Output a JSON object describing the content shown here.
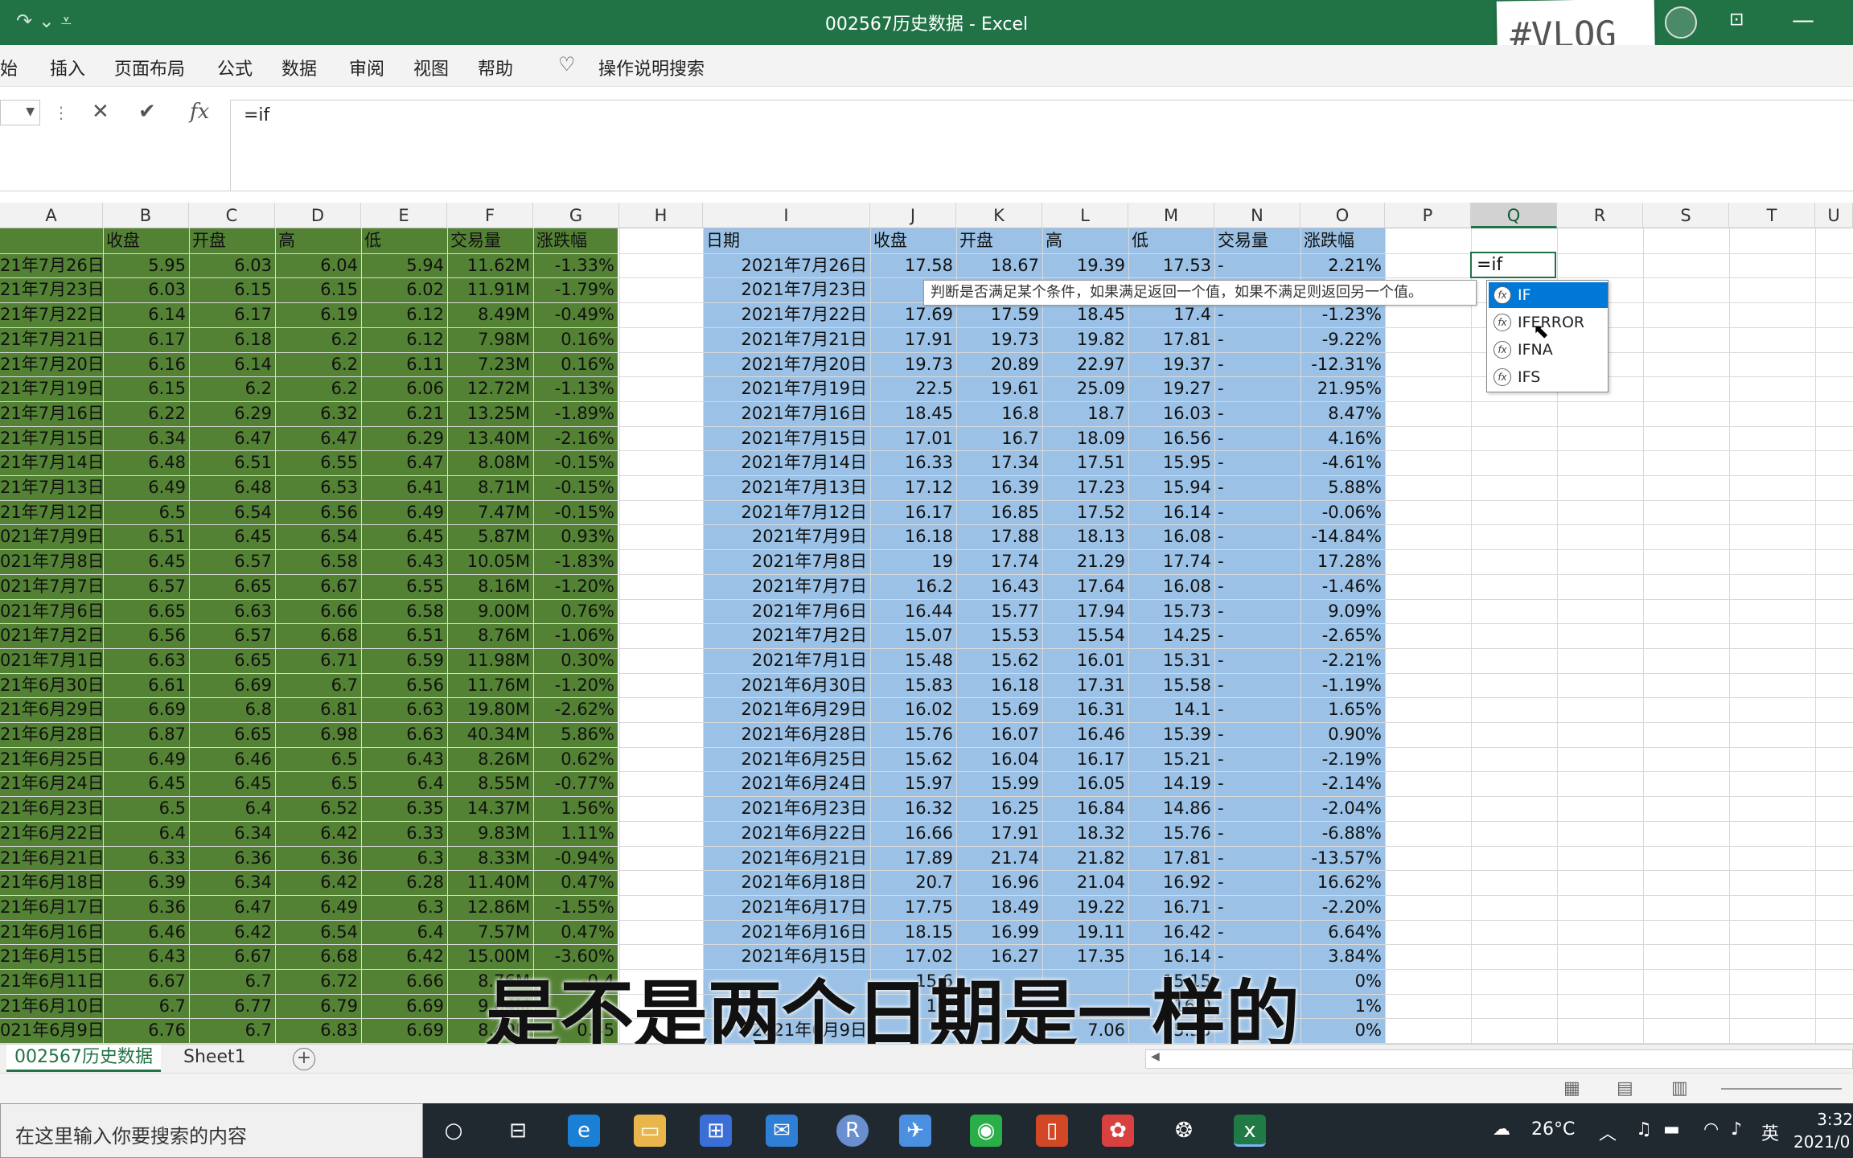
{
  "window": {
    "title": "002567历史数据  -  Excel"
  },
  "sticker": {
    "text": "#VLOG"
  },
  "menu": [
    "开始",
    "插入",
    "页面布局",
    "公式",
    "数据",
    "审阅",
    "视图",
    "帮助"
  ],
  "menu_shown": [
    "始",
    "插入",
    "页面布局",
    "公式",
    "数据",
    "审阅",
    "视图",
    "帮助"
  ],
  "tell_me": "操作说明搜索",
  "formula_bar": {
    "cancel": "✕",
    "enter": "✔",
    "fx": "fx",
    "content": "=if"
  },
  "columns": [
    "A",
    "B",
    "C",
    "D",
    "E",
    "F",
    "G",
    "H",
    "I",
    "J",
    "K",
    "L",
    "M",
    "N",
    "O",
    "P",
    "Q",
    "R",
    "S",
    "T",
    "U"
  ],
  "selected_column": "Q",
  "left_headers": {
    "a": "",
    "b": "收盘",
    "c": "开盘",
    "d": "高",
    "e": "低",
    "f": "交易量",
    "g": "涨跌幅"
  },
  "right_headers": {
    "i": "日期",
    "j": "收盘",
    "k": "开盘",
    "l": "高",
    "m": "低",
    "n": "交易量",
    "o": "涨跌幅"
  },
  "left_rows": [
    [
      "21年7月26日",
      "5.95",
      "6.03",
      "6.04",
      "5.94",
      "11.62M",
      "-1.33%"
    ],
    [
      "21年7月23日",
      "6.03",
      "6.15",
      "6.15",
      "6.02",
      "11.91M",
      "-1.79%"
    ],
    [
      "21年7月22日",
      "6.14",
      "6.17",
      "6.19",
      "6.12",
      "8.49M",
      "-0.49%"
    ],
    [
      "21年7月21日",
      "6.17",
      "6.18",
      "6.2",
      "6.12",
      "7.98M",
      "0.16%"
    ],
    [
      "21年7月20日",
      "6.16",
      "6.14",
      "6.2",
      "6.11",
      "7.23M",
      "0.16%"
    ],
    [
      "21年7月19日",
      "6.15",
      "6.2",
      "6.2",
      "6.06",
      "12.72M",
      "-1.13%"
    ],
    [
      "21年7月16日",
      "6.22",
      "6.29",
      "6.32",
      "6.21",
      "13.25M",
      "-1.89%"
    ],
    [
      "21年7月15日",
      "6.34",
      "6.47",
      "6.47",
      "6.29",
      "13.40M",
      "-2.16%"
    ],
    [
      "21年7月14日",
      "6.48",
      "6.51",
      "6.55",
      "6.47",
      "8.08M",
      "-0.15%"
    ],
    [
      "21年7月13日",
      "6.49",
      "6.48",
      "6.53",
      "6.41",
      "8.71M",
      "-0.15%"
    ],
    [
      "21年7月12日",
      "6.5",
      "6.54",
      "6.56",
      "6.49",
      "7.47M",
      "-0.15%"
    ],
    [
      "021年7月9日",
      "6.51",
      "6.45",
      "6.54",
      "6.45",
      "5.87M",
      "0.93%"
    ],
    [
      "021年7月8日",
      "6.45",
      "6.57",
      "6.58",
      "6.43",
      "10.05M",
      "-1.83%"
    ],
    [
      "021年7月7日",
      "6.57",
      "6.65",
      "6.67",
      "6.55",
      "8.16M",
      "-1.20%"
    ],
    [
      "021年7月6日",
      "6.65",
      "6.63",
      "6.66",
      "6.58",
      "9.00M",
      "0.76%"
    ],
    [
      "021年7月2日",
      "6.56",
      "6.57",
      "6.68",
      "6.51",
      "8.76M",
      "-1.06%"
    ],
    [
      "021年7月1日",
      "6.63",
      "6.65",
      "6.71",
      "6.59",
      "11.98M",
      "0.30%"
    ],
    [
      "21年6月30日",
      "6.61",
      "6.69",
      "6.7",
      "6.56",
      "11.76M",
      "-1.20%"
    ],
    [
      "21年6月29日",
      "6.69",
      "6.8",
      "6.81",
      "6.63",
      "19.80M",
      "-2.62%"
    ],
    [
      "21年6月28日",
      "6.87",
      "6.65",
      "6.98",
      "6.63",
      "40.34M",
      "5.86%"
    ],
    [
      "21年6月25日",
      "6.49",
      "6.46",
      "6.5",
      "6.43",
      "8.26M",
      "0.62%"
    ],
    [
      "21年6月24日",
      "6.45",
      "6.45",
      "6.5",
      "6.4",
      "8.55M",
      "-0.77%"
    ],
    [
      "21年6月23日",
      "6.5",
      "6.4",
      "6.52",
      "6.35",
      "14.37M",
      "1.56%"
    ],
    [
      "21年6月22日",
      "6.4",
      "6.34",
      "6.42",
      "6.33",
      "9.83M",
      "1.11%"
    ],
    [
      "21年6月21日",
      "6.33",
      "6.36",
      "6.36",
      "6.3",
      "8.33M",
      "-0.94%"
    ],
    [
      "21年6月18日",
      "6.39",
      "6.34",
      "6.42",
      "6.28",
      "11.40M",
      "0.47%"
    ],
    [
      "21年6月17日",
      "6.36",
      "6.47",
      "6.49",
      "6.3",
      "12.86M",
      "-1.55%"
    ],
    [
      "21年6月16日",
      "6.46",
      "6.42",
      "6.54",
      "6.4",
      "7.57M",
      "0.47%"
    ],
    [
      "21年6月15日",
      "6.43",
      "6.67",
      "6.68",
      "6.42",
      "15.00M",
      "-3.60%"
    ],
    [
      "21年6月11日",
      "6.67",
      "6.7",
      "6.72",
      "6.66",
      "8.76M",
      "-0.4"
    ],
    [
      "21年6月10日",
      "6.7",
      "6.77",
      "6.79",
      "6.69",
      "9.04M",
      ""
    ],
    [
      "021年6月9日",
      "6.76",
      "6.7",
      "6.83",
      "6.69",
      "8.49M",
      "0.45"
    ]
  ],
  "right_rows": [
    [
      "2021年7月26日",
      "17.58",
      "18.67",
      "19.39",
      "17.53",
      "-",
      "2.21%"
    ],
    [
      "2021年7月23日",
      "",
      "",
      "",
      "",
      "",
      ""
    ],
    [
      "2021年7月22日",
      "17.69",
      "17.59",
      "18.45",
      "17.4",
      "-",
      "-1.23%"
    ],
    [
      "2021年7月21日",
      "17.91",
      "19.73",
      "19.82",
      "17.81",
      "-",
      "-9.22%"
    ],
    [
      "2021年7月20日",
      "19.73",
      "20.89",
      "22.97",
      "19.37",
      "-",
      "-12.31%"
    ],
    [
      "2021年7月19日",
      "22.5",
      "19.61",
      "25.09",
      "19.27",
      "-",
      "21.95%"
    ],
    [
      "2021年7月16日",
      "18.45",
      "16.8",
      "18.7",
      "16.03",
      "-",
      "8.47%"
    ],
    [
      "2021年7月15日",
      "17.01",
      "16.7",
      "18.09",
      "16.56",
      "-",
      "4.16%"
    ],
    [
      "2021年7月14日",
      "16.33",
      "17.34",
      "17.51",
      "15.95",
      "-",
      "-4.61%"
    ],
    [
      "2021年7月13日",
      "17.12",
      "16.39",
      "17.23",
      "15.94",
      "-",
      "5.88%"
    ],
    [
      "2021年7月12日",
      "16.17",
      "16.85",
      "17.52",
      "16.14",
      "-",
      "-0.06%"
    ],
    [
      "2021年7月9日",
      "16.18",
      "17.88",
      "18.13",
      "16.08",
      "-",
      "-14.84%"
    ],
    [
      "2021年7月8日",
      "19",
      "17.74",
      "21.29",
      "17.74",
      "-",
      "17.28%"
    ],
    [
      "2021年7月7日",
      "16.2",
      "16.43",
      "17.64",
      "16.08",
      "-",
      "-1.46%"
    ],
    [
      "2021年7月6日",
      "16.44",
      "15.77",
      "17.94",
      "15.73",
      "-",
      "9.09%"
    ],
    [
      "2021年7月2日",
      "15.07",
      "15.53",
      "15.54",
      "14.25",
      "-",
      "-2.65%"
    ],
    [
      "2021年7月1日",
      "15.48",
      "15.62",
      "16.01",
      "15.31",
      "-",
      "-2.21%"
    ],
    [
      "2021年6月30日",
      "15.83",
      "16.18",
      "17.31",
      "15.58",
      "-",
      "-1.19%"
    ],
    [
      "2021年6月29日",
      "16.02",
      "15.69",
      "16.31",
      "14.1",
      "-",
      "1.65%"
    ],
    [
      "2021年6月28日",
      "15.76",
      "16.07",
      "16.46",
      "15.39",
      "-",
      "0.90%"
    ],
    [
      "2021年6月25日",
      "15.62",
      "16.04",
      "16.17",
      "15.21",
      "-",
      "-2.19%"
    ],
    [
      "2021年6月24日",
      "15.97",
      "15.99",
      "16.05",
      "14.19",
      "-",
      "-2.14%"
    ],
    [
      "2021年6月23日",
      "16.32",
      "16.25",
      "16.84",
      "14.86",
      "-",
      "-2.04%"
    ],
    [
      "2021年6月22日",
      "16.66",
      "17.91",
      "18.32",
      "15.76",
      "-",
      "-6.88%"
    ],
    [
      "2021年6月21日",
      "17.89",
      "21.74",
      "21.82",
      "17.81",
      "-",
      "-13.57%"
    ],
    [
      "2021年6月18日",
      "20.7",
      "16.96",
      "21.04",
      "16.92",
      "-",
      "16.62%"
    ],
    [
      "2021年6月17日",
      "17.75",
      "18.49",
      "19.22",
      "16.71",
      "-",
      "-2.20%"
    ],
    [
      "2021年6月16日",
      "18.15",
      "16.99",
      "19.11",
      "16.42",
      "-",
      "6.64%"
    ],
    [
      "2021年6月15日",
      "17.02",
      "16.27",
      "17.35",
      "16.14",
      "-",
      "3.84%"
    ],
    [
      "",
      "15.6",
      "",
      "",
      "15.15",
      "",
      "0%"
    ],
    [
      "",
      "16.",
      "",
      "",
      "16.0",
      "",
      "1%"
    ],
    [
      "2021年6月9日",
      "",
      "",
      "7.06",
      "15.55",
      "",
      "0%"
    ]
  ],
  "active_cell": {
    "value": "=if"
  },
  "tooltip": "判断是否满足某个条件，如果满足返回一个值，如果不满足则返回另一个值。",
  "autocomplete": [
    {
      "label": "IF",
      "selected": true
    },
    {
      "label": "IFERROR",
      "selected": false
    },
    {
      "label": "IFNA",
      "selected": false
    },
    {
      "label": "IFS",
      "selected": false
    }
  ],
  "subtitle": "是不是两个日期是一样的",
  "sheets": [
    {
      "label": "002567历史数据",
      "active": true
    },
    {
      "label": "Sheet1",
      "active": false
    }
  ],
  "add_sheet": "+",
  "taskbar": {
    "search_placeholder": "在这里输入你要搜索的内容",
    "weather": "26°C",
    "ime": "英",
    "time": "3:32",
    "date": "2021/0"
  },
  "colors": {
    "accent": "#217346",
    "green_fill": "#548235",
    "blue_fill": "#9bc2e6",
    "selection": "#0078d7"
  }
}
